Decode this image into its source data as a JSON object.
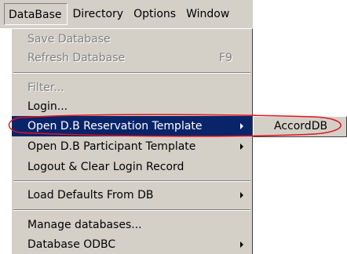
{
  "menubar": {
    "items": [
      {
        "label": "DataBase"
      },
      {
        "label": "Directory"
      },
      {
        "label": "Options"
      },
      {
        "label": "Window"
      }
    ]
  },
  "menu": {
    "items": [
      {
        "label": "Save Database",
        "enabled": false
      },
      {
        "label": "Refresh Database",
        "enabled": false,
        "shortcut": "F9"
      },
      {
        "label": "Filter...",
        "enabled": false
      },
      {
        "label": "Login...",
        "enabled": true
      },
      {
        "label": "Open D.B Reservation Template",
        "enabled": true,
        "selected": true,
        "has_submenu": true
      },
      {
        "label": "Open D.B Participant Template",
        "enabled": true,
        "has_submenu": true
      },
      {
        "label": "Logout & Clear Login Record",
        "enabled": true
      },
      {
        "label": "Load Defaults From DB",
        "enabled": true,
        "has_submenu": true
      },
      {
        "label": "Manage databases...",
        "enabled": true
      },
      {
        "label": "Database ODBC",
        "enabled": true,
        "has_submenu": true
      }
    ]
  },
  "submenu": {
    "items": [
      {
        "label": "AccordDB"
      }
    ]
  },
  "colors": {
    "menu_bg": "#d4d0c8",
    "selection": "#0a246a",
    "disabled_text": "#808080",
    "annotation": "#e0141e"
  }
}
